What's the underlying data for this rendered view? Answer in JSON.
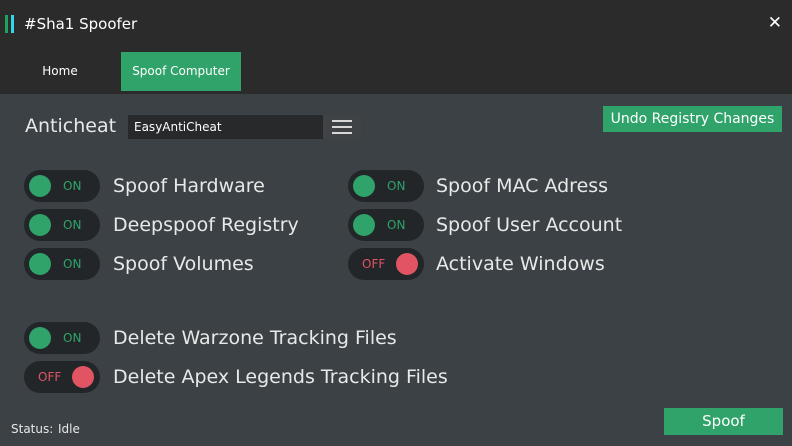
{
  "window": {
    "title": "#Sha1 Spoofer",
    "close_glyph": "✕",
    "accent_colors": [
      "#1ea35a",
      "#33d6e8"
    ]
  },
  "tabs": [
    {
      "label": "Home",
      "active": false
    },
    {
      "label": "Spoof Computer",
      "active": true
    }
  ],
  "anticheat": {
    "label": "Anticheat",
    "selected": "EasyAntiCheat",
    "menu_icon": "hamburger-menu-icon"
  },
  "undo_button": "Undo Registry Changes",
  "options": [
    {
      "label": "Spoof Hardware",
      "state": "ON"
    },
    {
      "label": "Deepspoof Registry",
      "state": "ON"
    },
    {
      "label": "Spoof Volumes",
      "state": "ON"
    },
    {
      "label": "Spoof MAC Adress",
      "state": "ON"
    },
    {
      "label": "Spoof User Account",
      "state": "ON"
    },
    {
      "label": "Activate Windows",
      "state": "OFF"
    },
    {
      "label": "Delete Warzone Tracking Files",
      "state": "ON"
    },
    {
      "label": "Delete Apex Legends Tracking Files",
      "state": "OFF"
    }
  ],
  "status": {
    "label": "Status:",
    "value": "Idle"
  },
  "spoof_button": "Spoof",
  "colors": {
    "accent": "#2fa36a",
    "off": "#e05463",
    "background": "#3b4145",
    "titlebar": "#2b2b2b"
  }
}
